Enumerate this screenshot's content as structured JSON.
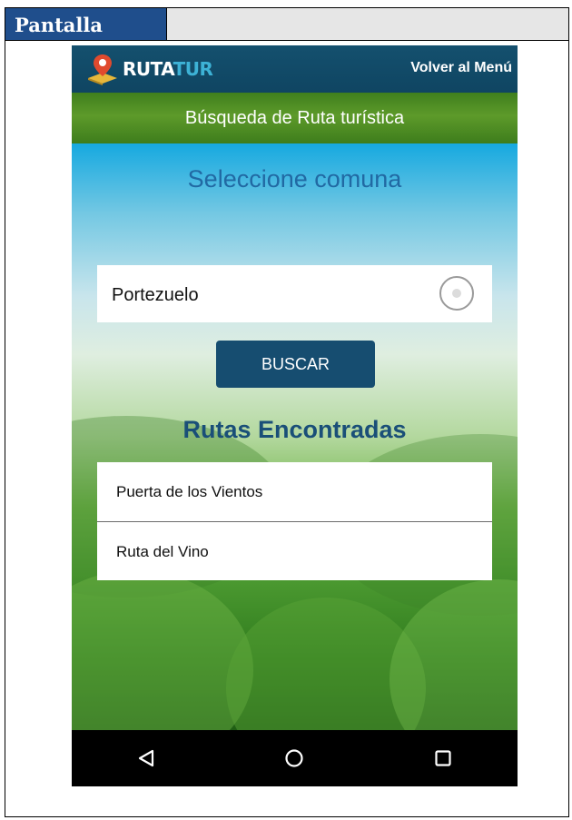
{
  "document": {
    "header_label": "Pantalla"
  },
  "app": {
    "logo": {
      "text_part1": "RUTA",
      "text_part2": "TUR"
    },
    "back_to_menu": "Volver al Menú",
    "screen_title": "Búsqueda de Ruta turística"
  },
  "search": {
    "heading": "Seleccione comuna",
    "selected_comuna": "Portezuelo",
    "button_label": "BUSCAR"
  },
  "results": {
    "heading": "Rutas Encontradas",
    "items": [
      {
        "label": "Puerta de los Vientos"
      },
      {
        "label": "Ruta del Vino"
      }
    ]
  },
  "nav": {
    "icons": [
      "back-icon",
      "home-icon",
      "recents-icon"
    ]
  },
  "colors": {
    "appbar": "#14506e",
    "titlebar": "#4f8c24",
    "button": "#164d70",
    "heading_blue": "#2169a3",
    "results_heading": "#1a4f78",
    "doc_header": "#1f4e8c"
  }
}
